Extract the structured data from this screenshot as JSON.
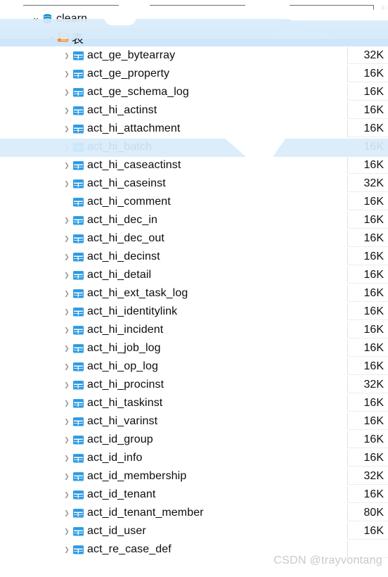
{
  "tree": {
    "database": {
      "label": "clearn",
      "icon": "database-icon",
      "expanded": true,
      "indent": 1
    },
    "folder": {
      "label": "表",
      "icon": "table-folder-icon",
      "expanded": true,
      "selected": true,
      "indent": 2
    },
    "size_column_header": "",
    "tables": [
      {
        "label": "act_ge_bytearray",
        "size": "32K",
        "expandable": true,
        "icon": "table-icon"
      },
      {
        "label": "act_ge_property",
        "size": "16K",
        "expandable": true,
        "icon": "table-icon"
      },
      {
        "label": "act_ge_schema_log",
        "size": "16K",
        "expandable": true,
        "icon": "table-icon"
      },
      {
        "label": "act_hi_actinst",
        "size": "16K",
        "expandable": true,
        "icon": "table-icon"
      },
      {
        "label": "act_hi_attachment",
        "size": "16K",
        "expandable": true,
        "icon": "table-icon"
      },
      {
        "label": "act_hi_batch",
        "size": "16K",
        "expandable": true,
        "icon": "table-icon",
        "highlighted": true
      },
      {
        "label": "act_hi_caseactinst",
        "size": "16K",
        "expandable": true,
        "icon": "table-icon"
      },
      {
        "label": "act_hi_caseinst",
        "size": "32K",
        "expandable": true,
        "icon": "table-icon"
      },
      {
        "label": "act_hi_comment",
        "size": "16K",
        "expandable": false,
        "icon": "table-icon"
      },
      {
        "label": "act_hi_dec_in",
        "size": "16K",
        "expandable": true,
        "icon": "table-icon"
      },
      {
        "label": "act_hi_dec_out",
        "size": "16K",
        "expandable": true,
        "icon": "table-icon"
      },
      {
        "label": "act_hi_decinst",
        "size": "16K",
        "expandable": true,
        "icon": "table-icon"
      },
      {
        "label": "act_hi_detail",
        "size": "16K",
        "expandable": true,
        "icon": "table-icon"
      },
      {
        "label": "act_hi_ext_task_log",
        "size": "16K",
        "expandable": true,
        "icon": "table-icon"
      },
      {
        "label": "act_hi_identitylink",
        "size": "16K",
        "expandable": true,
        "icon": "table-icon"
      },
      {
        "label": "act_hi_incident",
        "size": "16K",
        "expandable": true,
        "icon": "table-icon"
      },
      {
        "label": "act_hi_job_log",
        "size": "16K",
        "expandable": true,
        "icon": "table-icon"
      },
      {
        "label": "act_hi_op_log",
        "size": "16K",
        "expandable": true,
        "icon": "table-icon"
      },
      {
        "label": "act_hi_procinst",
        "size": "32K",
        "expandable": true,
        "icon": "table-icon"
      },
      {
        "label": "act_hi_taskinst",
        "size": "16K",
        "expandable": true,
        "icon": "table-icon"
      },
      {
        "label": "act_hi_varinst",
        "size": "16K",
        "expandable": true,
        "icon": "table-icon"
      },
      {
        "label": "act_id_group",
        "size": "16K",
        "expandable": true,
        "icon": "table-icon"
      },
      {
        "label": "act_id_info",
        "size": "16K",
        "expandable": true,
        "icon": "table-icon"
      },
      {
        "label": "act_id_membership",
        "size": "32K",
        "expandable": true,
        "icon": "table-icon"
      },
      {
        "label": "act_id_tenant",
        "size": "16K",
        "expandable": true,
        "icon": "table-icon"
      },
      {
        "label": "act_id_tenant_member",
        "size": "80K",
        "expandable": true,
        "icon": "table-icon"
      },
      {
        "label": "act_id_user",
        "size": "16K",
        "expandable": true,
        "icon": "table-icon"
      },
      {
        "label": "act_re_case_def",
        "size": "",
        "expandable": true,
        "icon": "table-icon"
      }
    ]
  },
  "watermark": {
    "text": "CSDN @trayvontang"
  },
  "colors": {
    "selection": "#cfe6fa",
    "database_icon": "#1a8fd6",
    "folder_icon": "#f0881a",
    "table_icon": "#2a9ae0",
    "text": "#0d0d0d",
    "watermark_text": "#c9c9c9"
  }
}
